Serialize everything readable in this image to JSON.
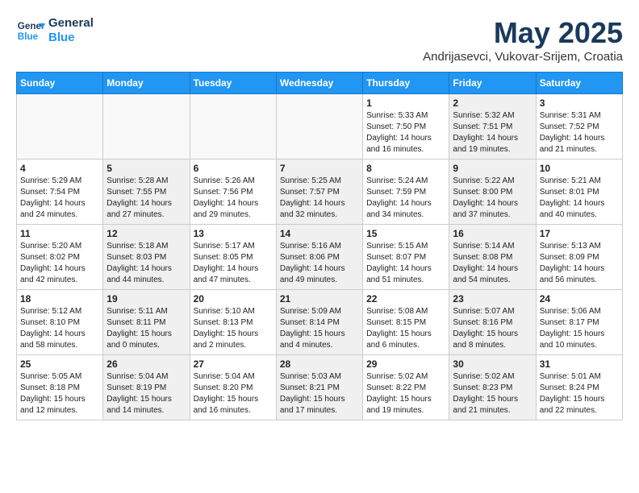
{
  "header": {
    "logo_line1": "General",
    "logo_line2": "Blue",
    "month": "May 2025",
    "location": "Andrijasevci, Vukovar-Srijem, Croatia"
  },
  "weekdays": [
    "Sunday",
    "Monday",
    "Tuesday",
    "Wednesday",
    "Thursday",
    "Friday",
    "Saturday"
  ],
  "weeks": [
    [
      {
        "day": "",
        "info": "",
        "shaded": false,
        "empty": true
      },
      {
        "day": "",
        "info": "",
        "shaded": false,
        "empty": true
      },
      {
        "day": "",
        "info": "",
        "shaded": false,
        "empty": true
      },
      {
        "day": "",
        "info": "",
        "shaded": false,
        "empty": true
      },
      {
        "day": "1",
        "info": "Sunrise: 5:33 AM\nSunset: 7:50 PM\nDaylight: 14 hours\nand 16 minutes.",
        "shaded": false,
        "empty": false
      },
      {
        "day": "2",
        "info": "Sunrise: 5:32 AM\nSunset: 7:51 PM\nDaylight: 14 hours\nand 19 minutes.",
        "shaded": true,
        "empty": false
      },
      {
        "day": "3",
        "info": "Sunrise: 5:31 AM\nSunset: 7:52 PM\nDaylight: 14 hours\nand 21 minutes.",
        "shaded": false,
        "empty": false
      }
    ],
    [
      {
        "day": "4",
        "info": "Sunrise: 5:29 AM\nSunset: 7:54 PM\nDaylight: 14 hours\nand 24 minutes.",
        "shaded": false,
        "empty": false
      },
      {
        "day": "5",
        "info": "Sunrise: 5:28 AM\nSunset: 7:55 PM\nDaylight: 14 hours\nand 27 minutes.",
        "shaded": true,
        "empty": false
      },
      {
        "day": "6",
        "info": "Sunrise: 5:26 AM\nSunset: 7:56 PM\nDaylight: 14 hours\nand 29 minutes.",
        "shaded": false,
        "empty": false
      },
      {
        "day": "7",
        "info": "Sunrise: 5:25 AM\nSunset: 7:57 PM\nDaylight: 14 hours\nand 32 minutes.",
        "shaded": true,
        "empty": false
      },
      {
        "day": "8",
        "info": "Sunrise: 5:24 AM\nSunset: 7:59 PM\nDaylight: 14 hours\nand 34 minutes.",
        "shaded": false,
        "empty": false
      },
      {
        "day": "9",
        "info": "Sunrise: 5:22 AM\nSunset: 8:00 PM\nDaylight: 14 hours\nand 37 minutes.",
        "shaded": true,
        "empty": false
      },
      {
        "day": "10",
        "info": "Sunrise: 5:21 AM\nSunset: 8:01 PM\nDaylight: 14 hours\nand 40 minutes.",
        "shaded": false,
        "empty": false
      }
    ],
    [
      {
        "day": "11",
        "info": "Sunrise: 5:20 AM\nSunset: 8:02 PM\nDaylight: 14 hours\nand 42 minutes.",
        "shaded": false,
        "empty": false
      },
      {
        "day": "12",
        "info": "Sunrise: 5:18 AM\nSunset: 8:03 PM\nDaylight: 14 hours\nand 44 minutes.",
        "shaded": true,
        "empty": false
      },
      {
        "day": "13",
        "info": "Sunrise: 5:17 AM\nSunset: 8:05 PM\nDaylight: 14 hours\nand 47 minutes.",
        "shaded": false,
        "empty": false
      },
      {
        "day": "14",
        "info": "Sunrise: 5:16 AM\nSunset: 8:06 PM\nDaylight: 14 hours\nand 49 minutes.",
        "shaded": true,
        "empty": false
      },
      {
        "day": "15",
        "info": "Sunrise: 5:15 AM\nSunset: 8:07 PM\nDaylight: 14 hours\nand 51 minutes.",
        "shaded": false,
        "empty": false
      },
      {
        "day": "16",
        "info": "Sunrise: 5:14 AM\nSunset: 8:08 PM\nDaylight: 14 hours\nand 54 minutes.",
        "shaded": true,
        "empty": false
      },
      {
        "day": "17",
        "info": "Sunrise: 5:13 AM\nSunset: 8:09 PM\nDaylight: 14 hours\nand 56 minutes.",
        "shaded": false,
        "empty": false
      }
    ],
    [
      {
        "day": "18",
        "info": "Sunrise: 5:12 AM\nSunset: 8:10 PM\nDaylight: 14 hours\nand 58 minutes.",
        "shaded": false,
        "empty": false
      },
      {
        "day": "19",
        "info": "Sunrise: 5:11 AM\nSunset: 8:11 PM\nDaylight: 15 hours\nand 0 minutes.",
        "shaded": true,
        "empty": false
      },
      {
        "day": "20",
        "info": "Sunrise: 5:10 AM\nSunset: 8:13 PM\nDaylight: 15 hours\nand 2 minutes.",
        "shaded": false,
        "empty": false
      },
      {
        "day": "21",
        "info": "Sunrise: 5:09 AM\nSunset: 8:14 PM\nDaylight: 15 hours\nand 4 minutes.",
        "shaded": true,
        "empty": false
      },
      {
        "day": "22",
        "info": "Sunrise: 5:08 AM\nSunset: 8:15 PM\nDaylight: 15 hours\nand 6 minutes.",
        "shaded": false,
        "empty": false
      },
      {
        "day": "23",
        "info": "Sunrise: 5:07 AM\nSunset: 8:16 PM\nDaylight: 15 hours\nand 8 minutes.",
        "shaded": true,
        "empty": false
      },
      {
        "day": "24",
        "info": "Sunrise: 5:06 AM\nSunset: 8:17 PM\nDaylight: 15 hours\nand 10 minutes.",
        "shaded": false,
        "empty": false
      }
    ],
    [
      {
        "day": "25",
        "info": "Sunrise: 5:05 AM\nSunset: 8:18 PM\nDaylight: 15 hours\nand 12 minutes.",
        "shaded": false,
        "empty": false
      },
      {
        "day": "26",
        "info": "Sunrise: 5:04 AM\nSunset: 8:19 PM\nDaylight: 15 hours\nand 14 minutes.",
        "shaded": true,
        "empty": false
      },
      {
        "day": "27",
        "info": "Sunrise: 5:04 AM\nSunset: 8:20 PM\nDaylight: 15 hours\nand 16 minutes.",
        "shaded": false,
        "empty": false
      },
      {
        "day": "28",
        "info": "Sunrise: 5:03 AM\nSunset: 8:21 PM\nDaylight: 15 hours\nand 17 minutes.",
        "shaded": true,
        "empty": false
      },
      {
        "day": "29",
        "info": "Sunrise: 5:02 AM\nSunset: 8:22 PM\nDaylight: 15 hours\nand 19 minutes.",
        "shaded": false,
        "empty": false
      },
      {
        "day": "30",
        "info": "Sunrise: 5:02 AM\nSunset: 8:23 PM\nDaylight: 15 hours\nand 21 minutes.",
        "shaded": true,
        "empty": false
      },
      {
        "day": "31",
        "info": "Sunrise: 5:01 AM\nSunset: 8:24 PM\nDaylight: 15 hours\nand 22 minutes.",
        "shaded": false,
        "empty": false
      }
    ]
  ]
}
